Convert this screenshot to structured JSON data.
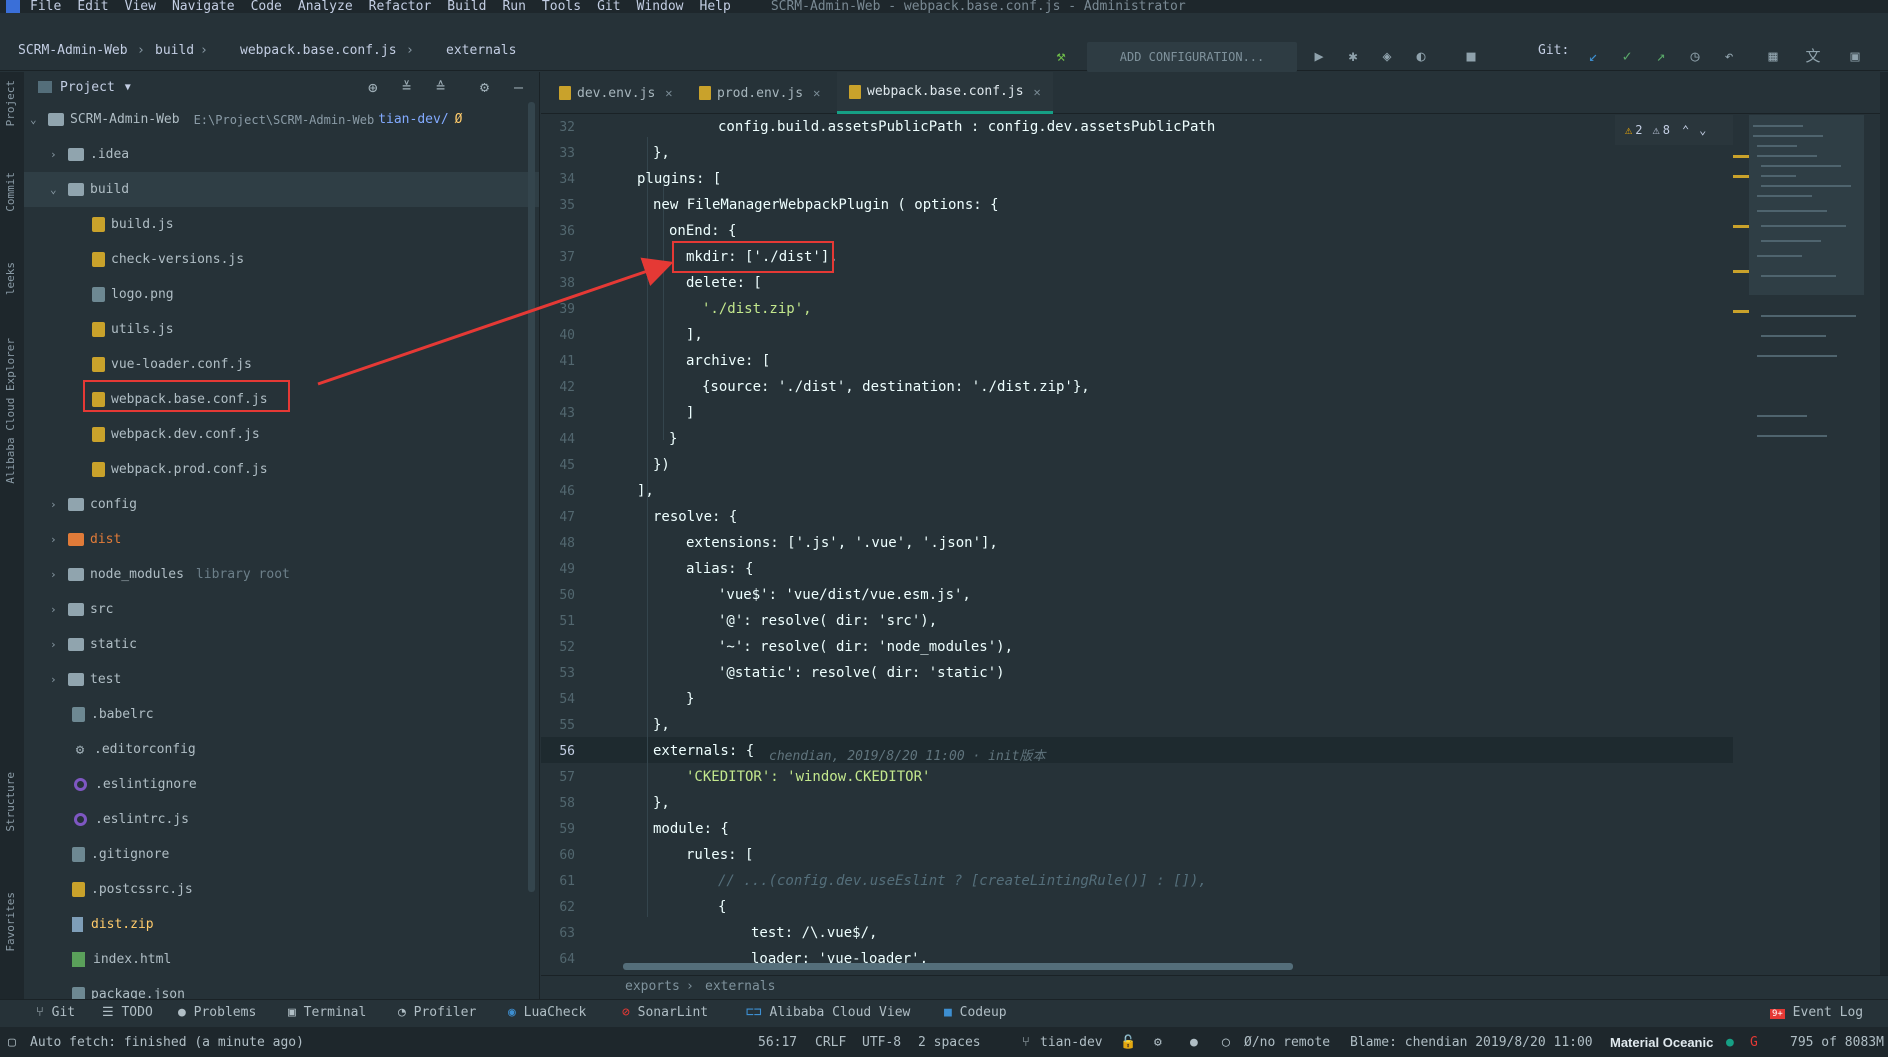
{
  "menu": {
    "items": [
      "File",
      "Edit",
      "View",
      "Navigate",
      "Code",
      "Analyze",
      "Refactor",
      "Build",
      "Run",
      "Tools",
      "Git",
      "Window",
      "Help"
    ],
    "window_title": "SCRM-Admin-Web - webpack.base.conf.js - Administrator"
  },
  "breadcrumb": {
    "project": "SCRM-Admin-Web",
    "folder": "build",
    "file": "webpack.base.conf.js",
    "symbol": "externals"
  },
  "toolbar": {
    "add_configuration": "ADD CONFIGURATION...",
    "git_label": "Git:"
  },
  "project_panel": {
    "title": "Project",
    "root_name": "SCRM-Admin-Web",
    "root_path": "E:\\Project\\SCRM-Admin-Web",
    "root_branch": "tian-dev/",
    "tree": [
      {
        "name": ".idea",
        "type": "folder",
        "expanded": false
      },
      {
        "name": "build",
        "type": "folder",
        "expanded": true
      },
      {
        "name": "build.js",
        "type": "js"
      },
      {
        "name": "check-versions.js",
        "type": "js"
      },
      {
        "name": "logo.png",
        "type": "png"
      },
      {
        "name": "utils.js",
        "type": "js"
      },
      {
        "name": "vue-loader.conf.js",
        "type": "js"
      },
      {
        "name": "webpack.base.conf.js",
        "type": "js",
        "highlighted": true
      },
      {
        "name": "webpack.dev.conf.js",
        "type": "js"
      },
      {
        "name": "webpack.prod.conf.js",
        "type": "js"
      },
      {
        "name": "config",
        "type": "folder",
        "expanded": false
      },
      {
        "name": "dist",
        "type": "folder",
        "expanded": false
      },
      {
        "name": "node_modules",
        "type": "folder",
        "expanded": false,
        "suffix": "library root"
      },
      {
        "name": "src",
        "type": "folder",
        "expanded": false
      },
      {
        "name": "static",
        "type": "folder",
        "expanded": false
      },
      {
        "name": "test",
        "type": "folder",
        "expanded": false
      },
      {
        "name": ".babelrc",
        "type": "file"
      },
      {
        "name": ".editorconfig",
        "type": "gear"
      },
      {
        "name": ".eslintignore",
        "type": "eslint"
      },
      {
        "name": ".eslintrc.js",
        "type": "eslint"
      },
      {
        "name": ".gitignore",
        "type": "file"
      },
      {
        "name": ".postcssrc.js",
        "type": "js"
      },
      {
        "name": "dist.zip",
        "type": "zip"
      },
      {
        "name": "index.html",
        "type": "html"
      },
      {
        "name": "package.json",
        "type": "file"
      }
    ]
  },
  "left_stripe": [
    "Project",
    "Commit",
    "leeks",
    "Alibaba Cloud Explorer",
    "Structure",
    "Favorites"
  ],
  "tabs": [
    {
      "label": "dev.env.js",
      "active": false
    },
    {
      "label": "prod.env.js",
      "active": false
    },
    {
      "label": "webpack.base.conf.js",
      "active": true
    }
  ],
  "inspection": {
    "warnings": "2",
    "weak_warnings": "8"
  },
  "editor": {
    "current_line": "56",
    "blame_inline": "chendian, 2019/8/20 11:00 · init版本",
    "lines": [
      {
        "n": "32",
        "t": "config.build.assetsPublicPath : config.dev.assetsPublicPath"
      },
      {
        "n": "33",
        "t": "},"
      },
      {
        "n": "34",
        "t": "plugins: ["
      },
      {
        "n": "35",
        "t": "new FileManagerWebpackPlugin ( options: {"
      },
      {
        "n": "36",
        "t": "onEnd: {"
      },
      {
        "n": "37",
        "t": "mkdir: ['./dist'],"
      },
      {
        "n": "38",
        "t": "delete: ["
      },
      {
        "n": "39",
        "t": "'./dist.zip',"
      },
      {
        "n": "40",
        "t": "],"
      },
      {
        "n": "41",
        "t": "archive: ["
      },
      {
        "n": "42",
        "t": "{source: './dist', destination: './dist.zip'},"
      },
      {
        "n": "43",
        "t": "]"
      },
      {
        "n": "44",
        "t": "}"
      },
      {
        "n": "45",
        "t": "})"
      },
      {
        "n": "46",
        "t": "],"
      },
      {
        "n": "47",
        "t": "resolve: {"
      },
      {
        "n": "48",
        "t": "extensions: ['.js', '.vue', '.json'],"
      },
      {
        "n": "49",
        "t": "alias: {"
      },
      {
        "n": "50",
        "t": "'vue$': 'vue/dist/vue.esm.js',"
      },
      {
        "n": "51",
        "t": "'@': resolve( dir: 'src'),"
      },
      {
        "n": "52",
        "t": "'~': resolve( dir: 'node_modules'),"
      },
      {
        "n": "53",
        "t": "'@static': resolve( dir: 'static')"
      },
      {
        "n": "54",
        "t": "}"
      },
      {
        "n": "55",
        "t": "},"
      },
      {
        "n": "56",
        "t": "externals: {"
      },
      {
        "n": "57",
        "t": "'CKEDITOR': 'window.CKEDITOR'"
      },
      {
        "n": "58",
        "t": "},"
      },
      {
        "n": "59",
        "t": "module: {"
      },
      {
        "n": "60",
        "t": "rules: ["
      },
      {
        "n": "61",
        "t": "// ...(config.dev.useEslint ? [createLintingRule()] : []),"
      },
      {
        "n": "62",
        "t": "{"
      },
      {
        "n": "63",
        "t": "test: /\\.vue$/,"
      },
      {
        "n": "64",
        "t": "loader: 'vue-loader',"
      }
    ]
  },
  "editor_breadcrumb": [
    "exports",
    "externals"
  ],
  "tool_windows": [
    "Git",
    "TODO",
    "Problems",
    "Terminal",
    "Profiler",
    "LuaCheck",
    "SonarLint",
    "Alibaba Cloud View",
    "Codeup"
  ],
  "event_log": "Event Log",
  "event_log_badge": "9+",
  "status": {
    "message": "Auto fetch: finished (a minute ago)",
    "position": "56:17",
    "line_sep": "CRLF",
    "encoding": "UTF-8",
    "indent": "2 spaces",
    "branch": "tian-dev",
    "remote": "Ø/no remote",
    "blame": "Blame: chendian 2019/8/20 11:00",
    "theme": "Material Oceanic",
    "memory": "795 of 8083M"
  },
  "colors": {
    "accent": "#16a085",
    "highlight_box": "#e53935",
    "background": "#263238"
  }
}
